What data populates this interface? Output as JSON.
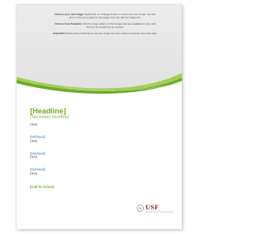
{
  "page": {
    "instructions": [
      {
        "heading": "Choose your own image:",
        "text": "Right-Click on 'Change Picture' to insert your own image. Use the green boxes as a guide for the image, then the 'Fill' the image box."
      },
      {
        "heading": "Choose from Template:",
        "text": "Visit the image gallery to find images that are available for use, add them to the image box as needed."
      },
      {
        "heading": "Important:",
        "text": "Delete these instructions once the image has been placed, and keep the footer logo."
      }
    ],
    "headline": "[Headline]",
    "secondary_headline": "[Secondary Headline]",
    "text_placeholder": "[Text]",
    "subheads": [
      {
        "label": "[Subhead]",
        "text": "[Text]"
      },
      {
        "label": "[Subhead]",
        "text": "[Text]"
      },
      {
        "label": "[Subhead]",
        "text": "[Text]"
      }
    ],
    "call_to_action": "[Call To Action]",
    "logo": {
      "wordmark": "USF",
      "subtitle": "UNIVERSITY OF SOUTH FLORIDA"
    }
  },
  "colors": {
    "brand_green": "#6aaa2b",
    "light_green": "#a6cc5a",
    "hero_gray": "#e9e9e9",
    "subhead_blue": "#4a74c4",
    "logo_red": "#8c1d22"
  }
}
